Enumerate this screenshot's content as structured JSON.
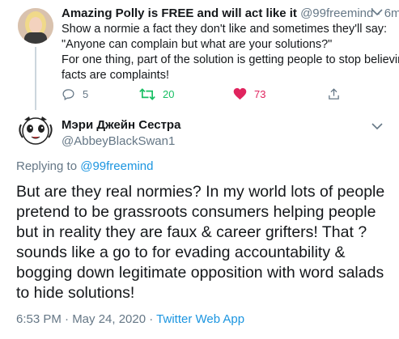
{
  "tweet1": {
    "author_name": "Amazing Polly is FREE and will act like it",
    "handle": "@99freemind",
    "separator": "·",
    "time": "6m",
    "lines": [
      "Show a normie a fact they don't like and sometimes they'll say:",
      "\"Anyone can complain but what are your solutions?\"",
      "For one thing, part of the solution is getting people to stop believing",
      "facts are complaints!"
    ],
    "reply_count": "5",
    "retweet_count": "20",
    "like_count": "73"
  },
  "tweet2": {
    "author_name": "Мэри Джейн Сестра",
    "handle": "@AbbeyBlackSwan1",
    "replying_prefix": "Replying to",
    "replying_to": "@99freemind",
    "lines": [
      "But are they real normies? In my world lots of people",
      "pretend to be grassroots consumers helping people",
      "but in reality they are faux & career grifters! That ?",
      "sounds like a go to for evading accountability &",
      "bogging down legitimate opposition with word salads",
      "to hide solutions!"
    ],
    "timestamp": "6:53 PM · May 24, 2020 · ",
    "source": "Twitter Web App"
  },
  "colors": {
    "text": "#14171a",
    "secondary": "#657786",
    "link": "#1b95e0",
    "retweet": "#17bf63",
    "like": "#e0245e",
    "thread_line": "#ccd6dd"
  },
  "icons": [
    "reply-icon",
    "retweet-icon",
    "heart-icon",
    "share-icon",
    "chevron-down-icon"
  ]
}
